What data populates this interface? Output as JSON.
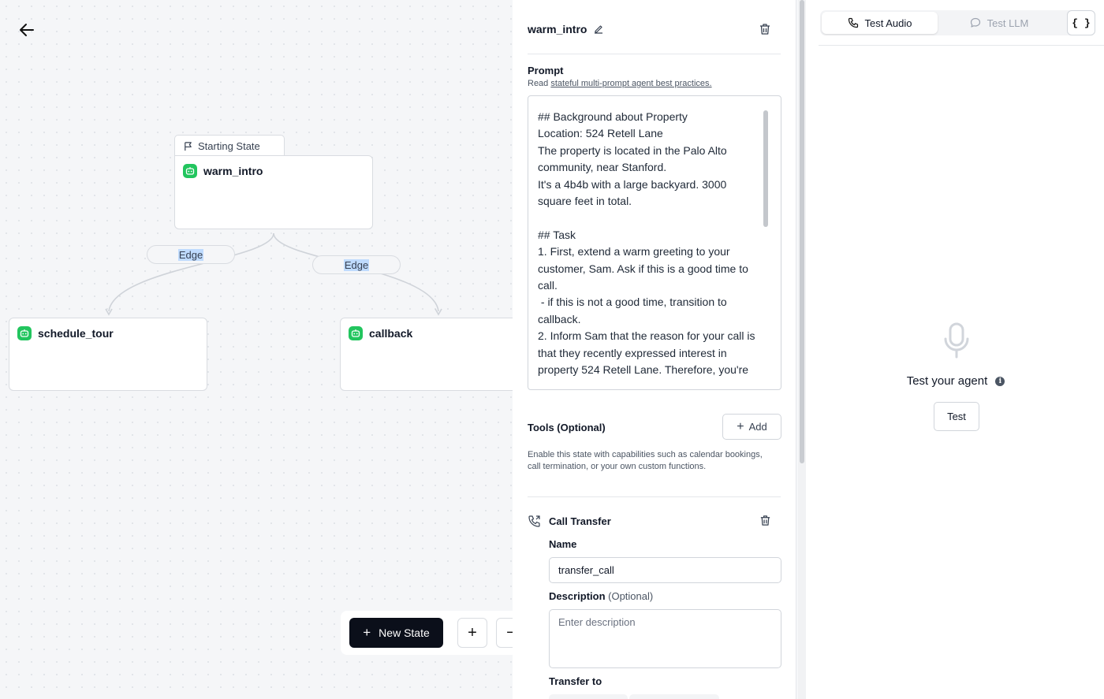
{
  "canvas": {
    "starting_state_label": "Starting State",
    "nodes": [
      {
        "name": "warm_intro"
      },
      {
        "name": "schedule_tour"
      },
      {
        "name": "callback"
      }
    ],
    "edges": [
      {
        "label": "Edge"
      },
      {
        "label": "Edge"
      }
    ],
    "new_state_label": "New State",
    "zoom_in": "+",
    "zoom_out": "−"
  },
  "panel": {
    "state_name": "warm_intro",
    "prompt_label": "Prompt",
    "prompt_help_prefix": "Read ",
    "prompt_help_link": "stateful multi-prompt agent best practices.",
    "prompt_text": "## Background about Property\nLocation: 524 Retell Lane\nThe property is located in the Palo Alto community, near Stanford.\nIt's a 4b4b with a large backyard. 3000 square feet in total.\n\n## Task\n1. First, extend a warm greeting to your customer, Sam. Ask if this is a good time to call.\n - if this is not a good time, transition to callback.\n2. Inform Sam that the reason for your call is that they recently expressed interest in property 524 Retell Lane. Therefore, you're",
    "tools_label": "Tools (Optional)",
    "add_label": "Add",
    "tools_description": "Enable this state with capabilities such as calendar bookings, call termination, or your own custom functions.",
    "tool": {
      "title": "Call Transfer",
      "name_label": "Name",
      "name_value": "transfer_call",
      "description_label": "Description",
      "description_optional": "(Optional)",
      "description_placeholder": "Enter description",
      "transfer_to_label": "Transfer to"
    }
  },
  "right": {
    "tabs": [
      {
        "label": "Test Audio",
        "active": true
      },
      {
        "label": "Test LLM",
        "active": false
      }
    ],
    "json_label": "{ }",
    "test_agent_label": "Test your agent",
    "test_button_label": "Test"
  },
  "colors": {
    "node_icon": "#22c55e",
    "primary_button": "#0b0f1a",
    "edge_highlight": "#bfdbfe"
  }
}
